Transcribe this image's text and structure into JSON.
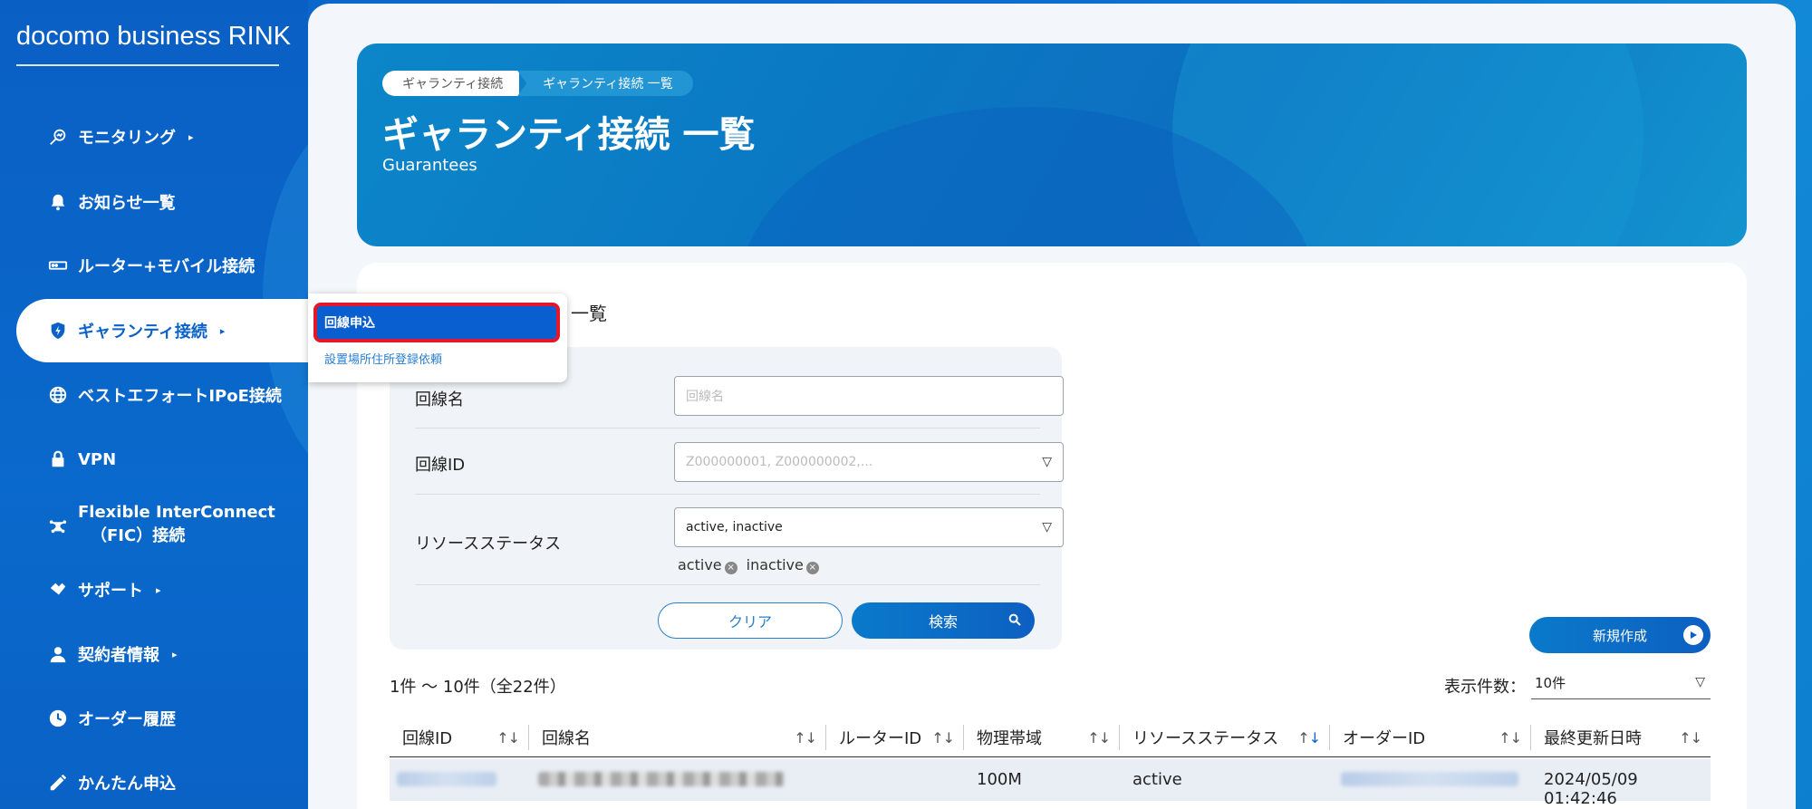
{
  "brand": "docomo business RINK",
  "sidebar": {
    "items": [
      {
        "label": "モニタリング",
        "caret": "▸",
        "icon": "monitoring-search-icon"
      },
      {
        "label": "お知らせ一覧",
        "icon": "bell-icon"
      },
      {
        "label": "ルーター+モバイル接続",
        "icon": "router-icon"
      },
      {
        "label": "ギャランティ接続",
        "caret": "▸",
        "icon": "shield-bolt-icon"
      },
      {
        "label": "ベストエフォートIPoE接続",
        "icon": "globe-icon"
      },
      {
        "label": "VPN",
        "icon": "lock-icon"
      },
      {
        "label": "Flexible InterConnect",
        "label2": "（FIC）接続",
        "icon": "network-icon"
      },
      {
        "label": "サポート",
        "caret": "▸",
        "icon": "handshake-icon"
      },
      {
        "label": "契約者情報",
        "caret": "▸",
        "icon": "user-icon"
      },
      {
        "label": "オーダー履歴",
        "icon": "clock-icon"
      },
      {
        "label": "かんたん申込",
        "icon": "edit-icon"
      }
    ]
  },
  "popup": {
    "item1": "回線申込",
    "item2": "設置場所住所登録依頼"
  },
  "hero": {
    "crumb1": "ギャランティ接続",
    "crumb2": "ギャランティ接続 一覧",
    "title": "ギャランティ接続 一覧",
    "subtitle": "Guarantees"
  },
  "section_title": "一覧",
  "filters": {
    "name_label": "回線名",
    "name_placeholder": "回線名",
    "id_label": "回線ID",
    "id_placeholder": "Z000000001, Z000000002,...",
    "status_label": "リソースステータス",
    "status_value": "active, inactive",
    "chip1": "active",
    "chip2": "inactive",
    "clear": "クリア",
    "search": "検索"
  },
  "new_button": "新規作成",
  "count_text": "1件 〜 10件（全22件）",
  "perpage_label": "表示件数：",
  "perpage_value": "10件",
  "table": {
    "headers": [
      "回線ID",
      "回線名",
      "ルーターID",
      "物理帯域",
      "リソースステータス",
      "オーダーID",
      "最終更新日時"
    ],
    "row1": {
      "bandwidth": "100M",
      "status": "active",
      "updated": "2024/05/09 01:42:46"
    }
  },
  "colors": {
    "accent": "#0a62c8",
    "highlight_border": "#e3162a"
  }
}
